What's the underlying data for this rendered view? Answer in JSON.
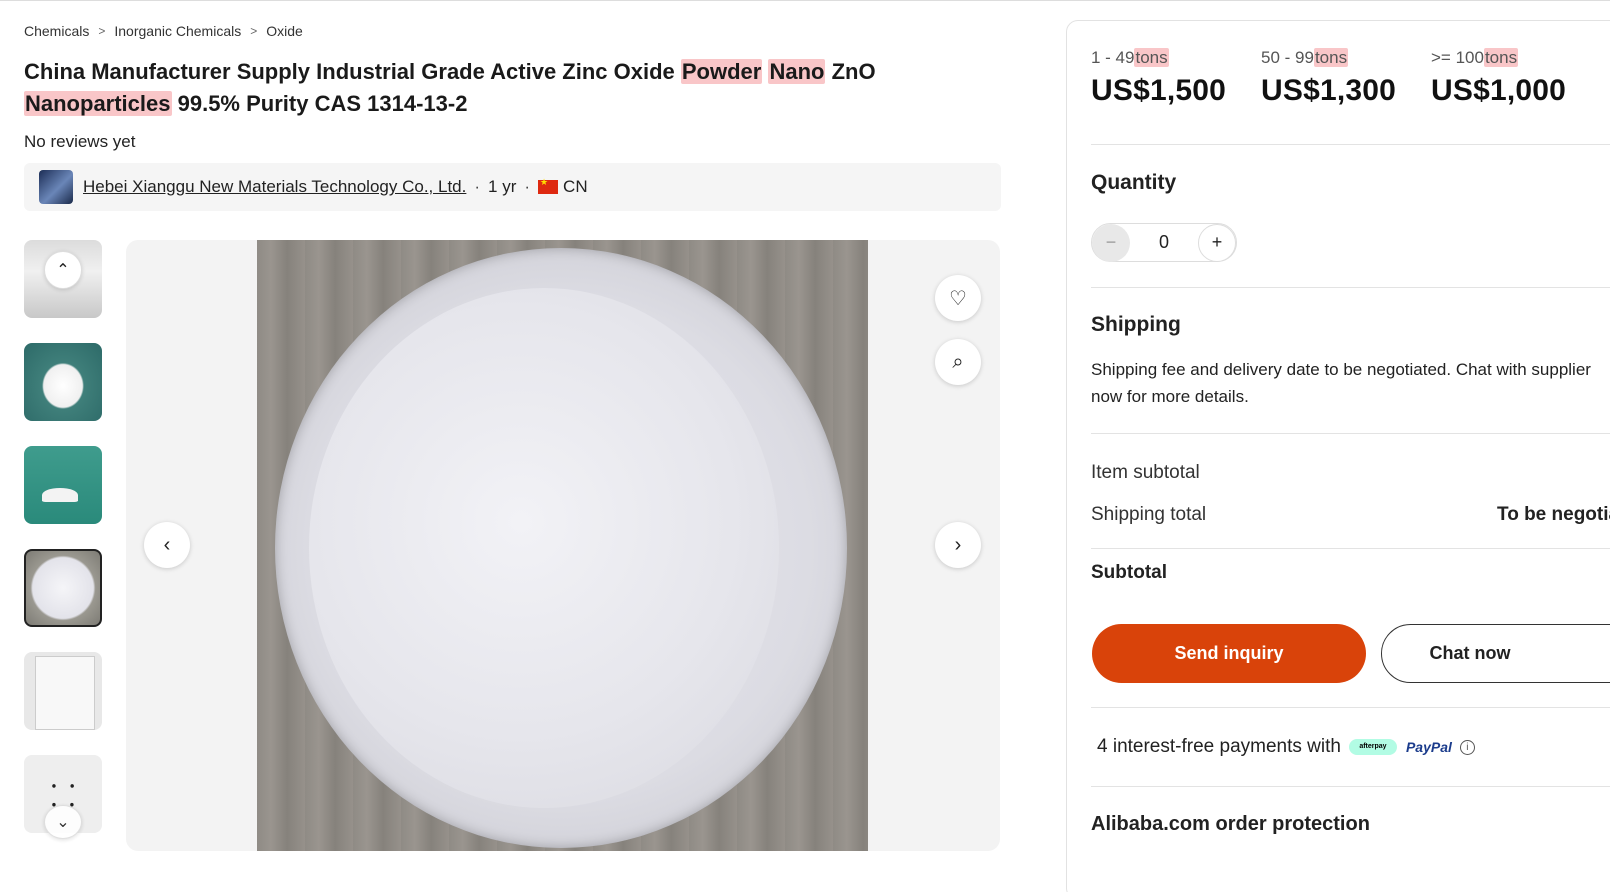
{
  "breadcrumb": [
    "Chemicals",
    "Inorganic Chemicals",
    "Oxide"
  ],
  "title": {
    "t1": "China Manufacturer Supply Industrial Grade Active Zinc Oxide ",
    "h1": "Powder",
    "t2": " ",
    "h2": "Nano",
    "t3": " ZnO ",
    "h3": "Nanoparticles",
    "t4": " 99.5% Purity CAS 1314-13-2"
  },
  "reviews": "No reviews yet",
  "supplier": {
    "name": "Hebei Xianggu New Materials Technology Co., Ltd.",
    "years": "1 yr",
    "country": "CN"
  },
  "gallery": {
    "thumb_up_glyph": "⌃",
    "thumb_down_glyph": "⌄",
    "thumb6_glyph": "⸬",
    "prev_glyph": "‹",
    "next_glyph": "›",
    "heart_glyph": "♡",
    "lens_glyph": "⌕"
  },
  "pricing": {
    "tiers": [
      {
        "range": "1 - 49",
        "unit": "tons",
        "price": "US$1,500"
      },
      {
        "range": "50 - 99",
        "unit": "tons",
        "price": "US$1,300"
      },
      {
        "range": ">= 100",
        "unit": "tons",
        "price": "US$1,000"
      }
    ]
  },
  "quantity": {
    "label": "Quantity",
    "value": "0",
    "minus": "−",
    "plus": "+"
  },
  "shipping": {
    "title": "Shipping",
    "text": "Shipping fee and delivery date to be negotiated. Chat with supplier now for more details."
  },
  "totals": {
    "item_subtotal_label": "Item subtotal",
    "shipping_total_label": "Shipping total",
    "shipping_total_value": "To be negotiated",
    "subtotal_label": "Subtotal"
  },
  "actions": {
    "send_inquiry": "Send inquiry",
    "chat_now": "Chat now"
  },
  "payments": {
    "text": "4 interest-free payments with",
    "afterpay": "afterpay",
    "paypal": "PayPal",
    "info": "i"
  },
  "protection": "Alibaba.com order protection"
}
